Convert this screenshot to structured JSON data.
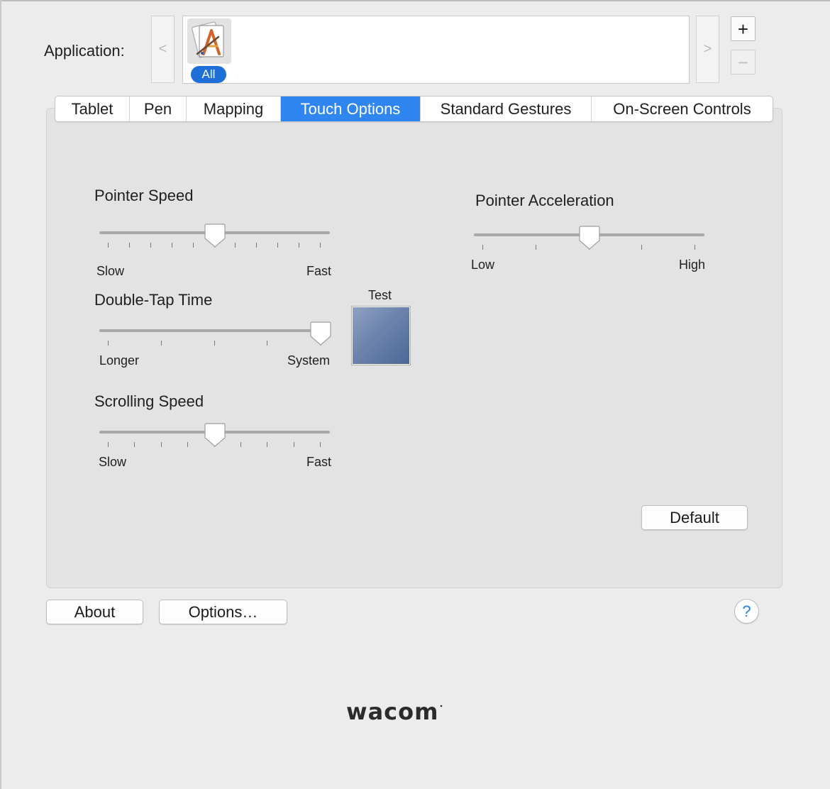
{
  "application": {
    "label": "Application:",
    "prev_label": "<",
    "next_label": ">",
    "add_label": "+",
    "remove_label": "−",
    "items": [
      {
        "name": "All",
        "icon": "application-icon",
        "selected": true
      }
    ]
  },
  "tabs": [
    {
      "label": "Tablet",
      "active": false
    },
    {
      "label": "Pen",
      "active": false
    },
    {
      "label": "Mapping",
      "active": false
    },
    {
      "label": "Touch Options",
      "active": true
    },
    {
      "label": "Standard Gestures",
      "active": false
    },
    {
      "label": "On-Screen Controls",
      "active": false
    }
  ],
  "touch_options": {
    "pointer_speed": {
      "label": "Pointer Speed",
      "min_label": "Slow",
      "max_label": "Fast",
      "value": 0.5,
      "ticks": 11
    },
    "double_tap_time": {
      "label": "Double-Tap Time",
      "min_label": "Longer",
      "max_label": "System",
      "value": 1.0,
      "ticks": 5
    },
    "scrolling_speed": {
      "label": "Scrolling Speed",
      "min_label": "Slow",
      "max_label": "Fast",
      "value": 0.5,
      "ticks": 9
    },
    "pointer_acceleration": {
      "label": "Pointer Acceleration",
      "min_label": "Low",
      "max_label": "High",
      "value": 0.5,
      "ticks": 5
    },
    "test_label": "Test",
    "default_label": "Default"
  },
  "footer": {
    "about_label": "About",
    "options_label": "Options…",
    "help_label": "?"
  },
  "colors": {
    "accent": "#2f86f0",
    "badge": "#1e6fd9",
    "test_area": "#6c84ad"
  }
}
